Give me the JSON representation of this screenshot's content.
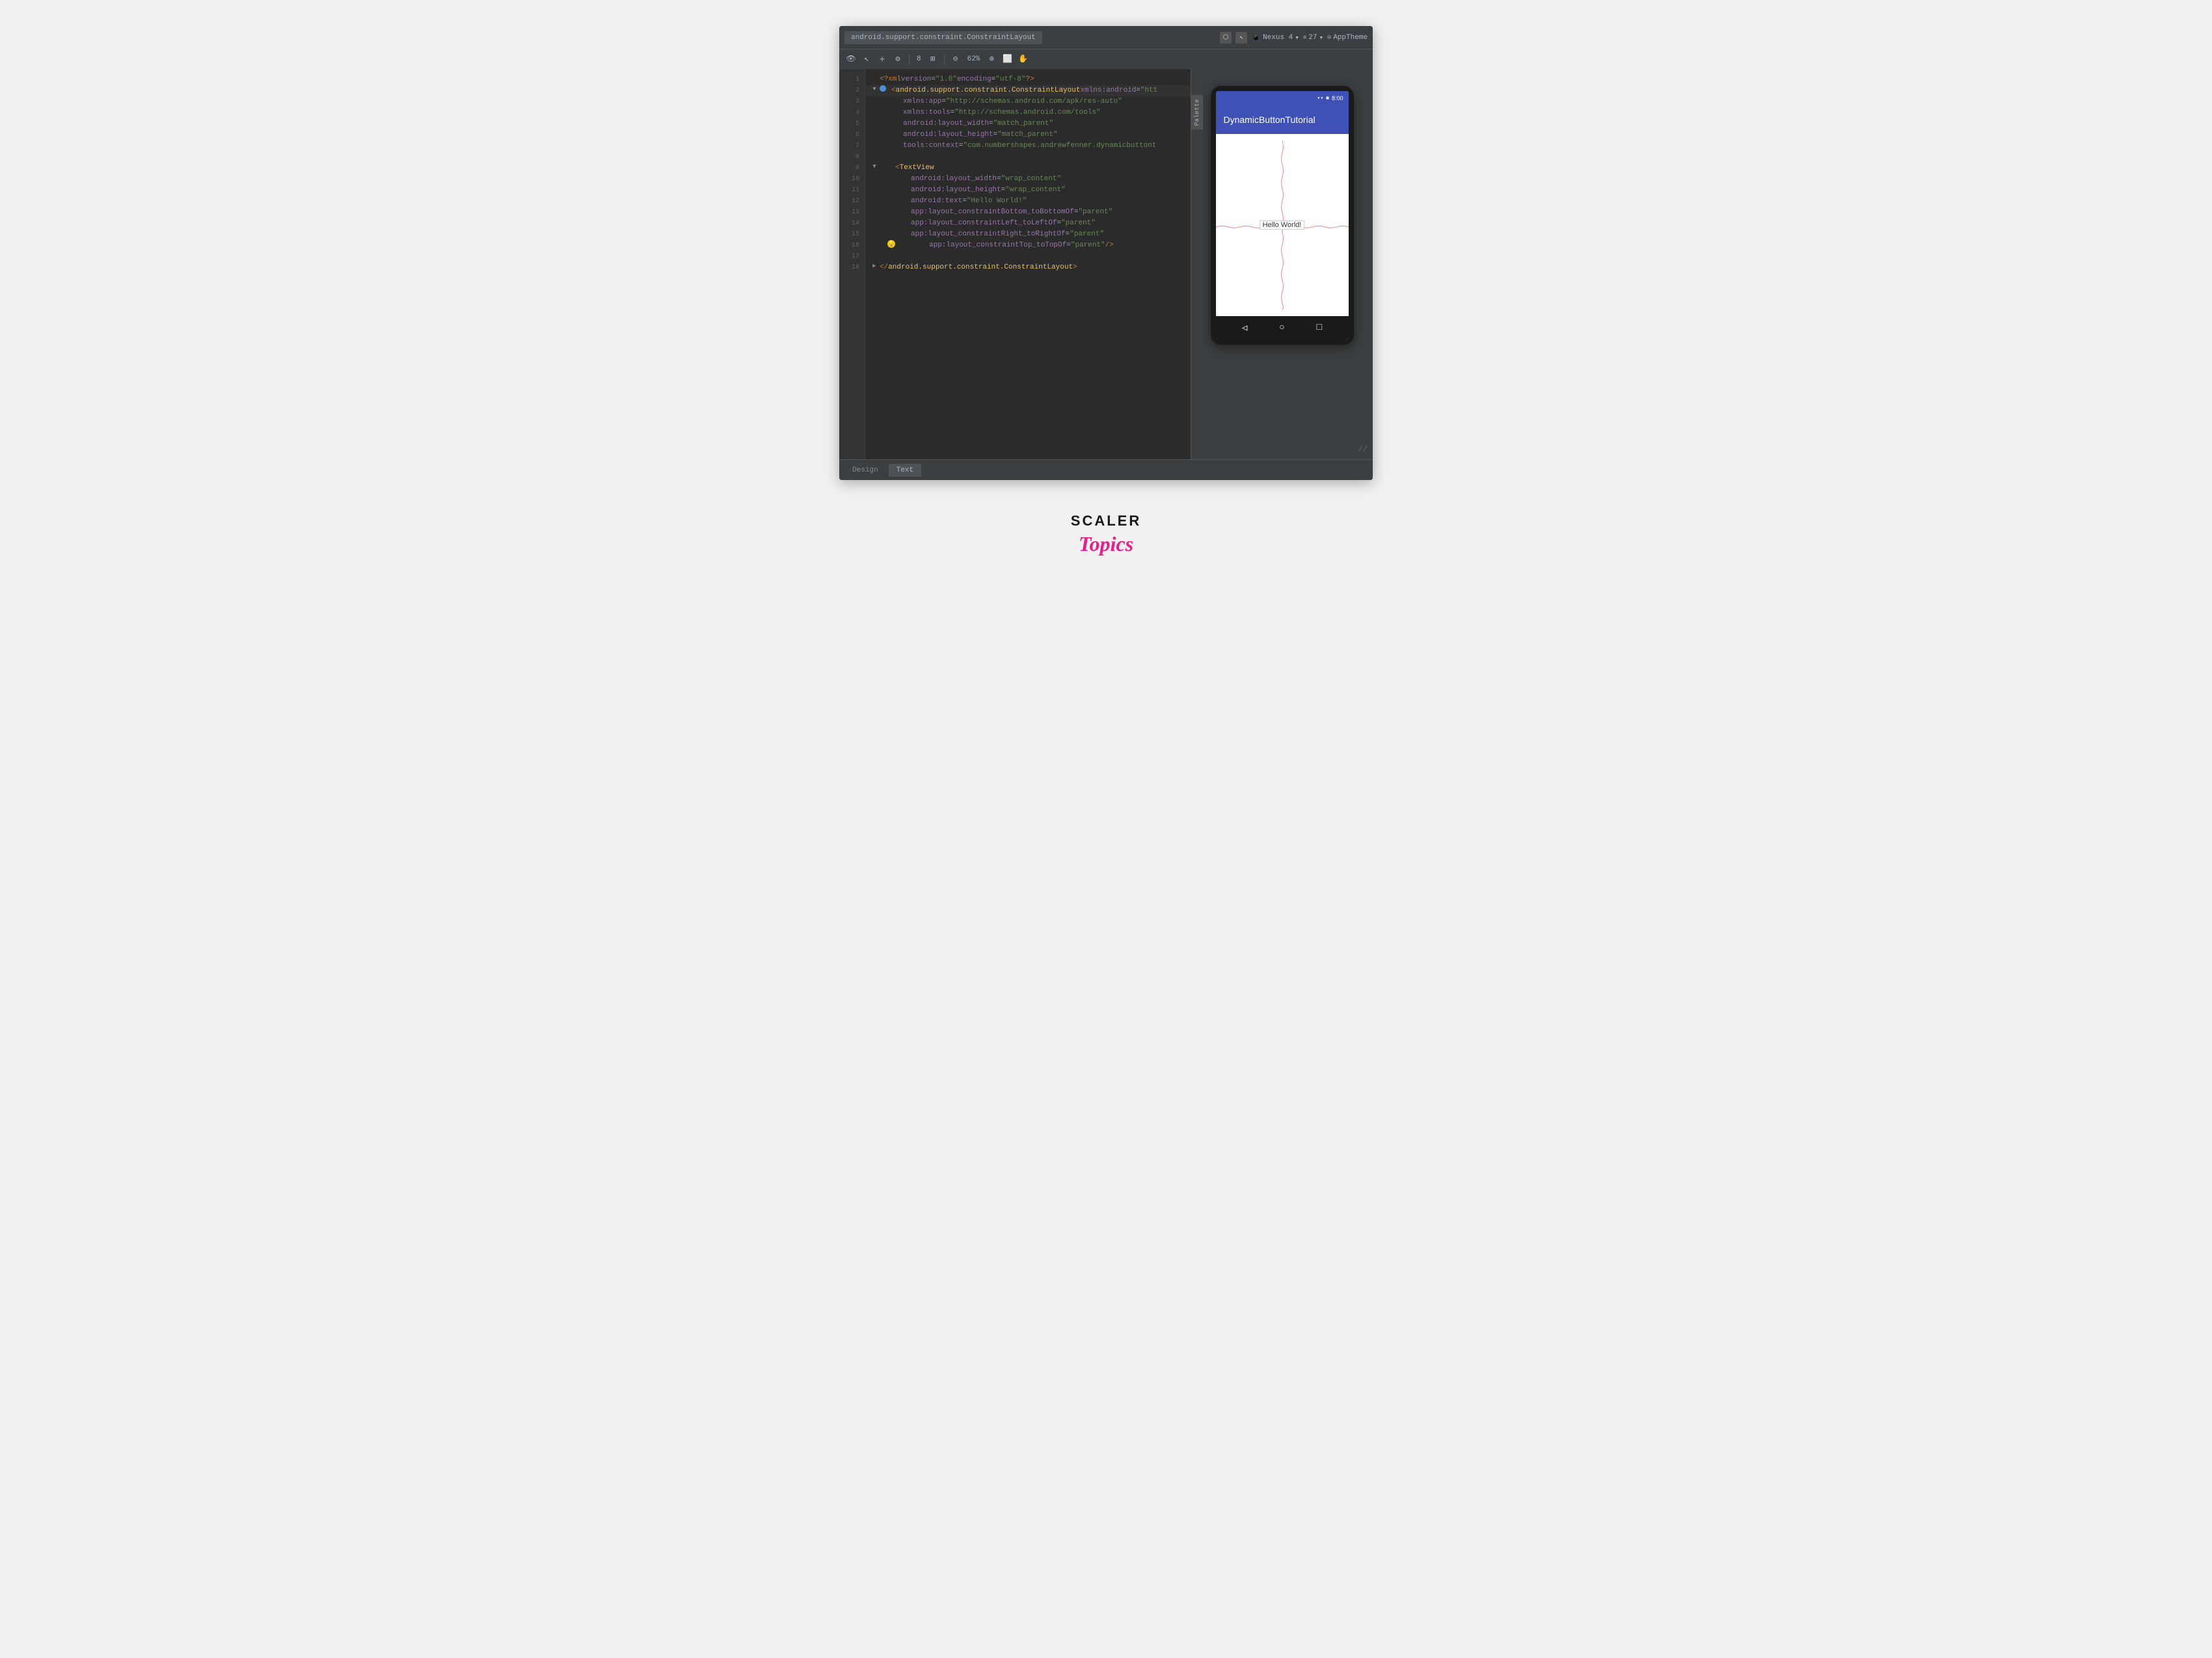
{
  "toolbar": {
    "tab_label": "android.support.constraint.ConstraintLayout",
    "device": "Nexus 4",
    "api_level": "27",
    "theme": "AppTheme",
    "zoom": "62%",
    "palette_label": "Palette"
  },
  "code": {
    "lines": [
      {
        "num": "1",
        "indent": 0,
        "content": "xml_declaration",
        "text": "<?xml version=\"1.0\" encoding=\"utf-8\"?>"
      },
      {
        "num": "2",
        "indent": 0,
        "content": "root_open",
        "text": "<android.support.constraint.ConstraintLayout xmlns:android=\"htt"
      },
      {
        "num": "3",
        "indent": 1,
        "content": "xmlns_app",
        "text": "xmlns:app=\"http://schemas.android.com/apk/res-auto\""
      },
      {
        "num": "4",
        "indent": 1,
        "content": "xmlns_tools",
        "text": "xmlns:tools=\"http://schemas.android.com/tools\""
      },
      {
        "num": "5",
        "indent": 1,
        "content": "layout_width",
        "text": "android:layout_width=\"match_parent\""
      },
      {
        "num": "6",
        "indent": 1,
        "content": "layout_height",
        "text": "android:layout_height=\"match_parent\""
      },
      {
        "num": "7",
        "indent": 1,
        "content": "tools_context",
        "text": "tools:context=\"com.numbershapes.andrewfenner.dynamicbuttont"
      },
      {
        "num": "8",
        "indent": 0,
        "content": "blank",
        "text": ""
      },
      {
        "num": "9",
        "indent": 1,
        "content": "textview_open",
        "text": "<TextView"
      },
      {
        "num": "10",
        "indent": 2,
        "content": "tv_width",
        "text": "android:layout_width=\"wrap_content\""
      },
      {
        "num": "11",
        "indent": 2,
        "content": "tv_height",
        "text": "android:layout_height=\"wrap_content\""
      },
      {
        "num": "12",
        "indent": 2,
        "content": "tv_text",
        "text": "android:text=\"Hello World!\""
      },
      {
        "num": "13",
        "indent": 2,
        "content": "constraint_bottom",
        "text": "app:layout_constraintBottom_toBottomOf=\"parent\""
      },
      {
        "num": "14",
        "indent": 2,
        "content": "constraint_left",
        "text": "app:layout_constraintLeft_toLeftOf=\"parent\""
      },
      {
        "num": "15",
        "indent": 2,
        "content": "constraint_right",
        "text": "app:layout_constraintRight_toRightOf=\"parent\""
      },
      {
        "num": "16",
        "indent": 2,
        "content": "constraint_top",
        "text": "app:layout_constraintTop_toTopOf=\"parent\" />"
      },
      {
        "num": "17",
        "indent": 0,
        "content": "blank",
        "text": ""
      },
      {
        "num": "18",
        "indent": 0,
        "content": "root_close",
        "text": "</android.support.constraint.ConstraintLayout>"
      }
    ]
  },
  "device_preview": {
    "status_time": "8:00",
    "app_title": "DynamicButtonTutorial",
    "hello_world": "Hello World!",
    "nav_back": "◁",
    "nav_home": "○",
    "nav_recent": "□"
  },
  "bottom_tabs": {
    "design": "Design",
    "text": "Text"
  },
  "scaler": {
    "title": "SCALER",
    "subtitle": "Topics"
  }
}
